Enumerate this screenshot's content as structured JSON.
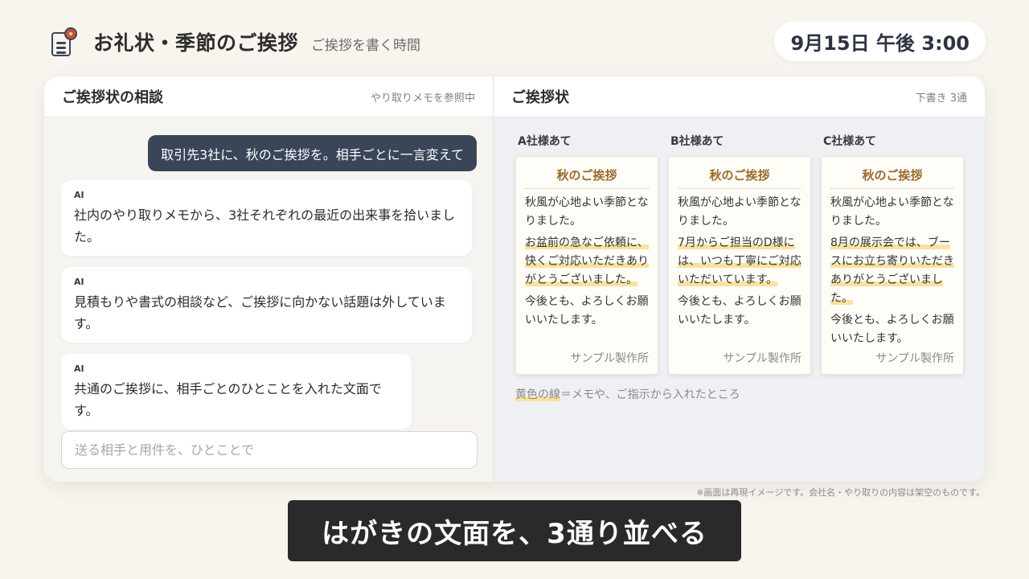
{
  "app": {
    "icon": "letter-icon",
    "title": "お礼状・季節のご挨拶",
    "subtitle": "ご挨拶を書く時間",
    "clock": "9月15日 午後 3:00"
  },
  "chat_panel": {
    "title": "ご挨拶状の相談",
    "meta": "やり取りメモを参照中",
    "user_message": "取引先3社に、秋のご挨拶を。相手ごとに一言変えて",
    "ai_messages": [
      {
        "label": "AI",
        "text": "社内のやり取りメモから、3社それぞれの最近の出来事を拾いました。"
      },
      {
        "label": "AI",
        "text": "見積もりや書式の相談など、ご挨拶に向かない話題は外しています。"
      },
      {
        "label": "AI",
        "text": "共通のご挨拶に、相手ごとのひとことを入れた文面です。"
      }
    ],
    "input_placeholder": "送る相手と用件を、ひとことで"
  },
  "letters_panel": {
    "title": "ご挨拶状",
    "meta": "下書き 3通",
    "letters": [
      {
        "to": "A社様あて",
        "title": "秋のご挨拶",
        "opening": "秋風が心地よい季節となりました。",
        "personal": "お盆前の急なご依頼に、快くご対応いただきありがとうございました。",
        "closing": "今後とも、よろしくお願いいたします。",
        "sign": "サンプル製作所"
      },
      {
        "to": "B社様あて",
        "title": "秋のご挨拶",
        "opening": "秋風が心地よい季節となりました。",
        "personal": "7月からご担当のD様には、いつも丁寧にご対応いただいています。",
        "closing": "今後とも、よろしくお願いいたします。",
        "sign": "サンプル製作所"
      },
      {
        "to": "C社様あて",
        "title": "秋のご挨拶",
        "opening": "秋風が心地よい季節となりました。",
        "personal": "8月の展示会では、ブースにお立ち寄りいただきありがとうございました。",
        "closing": "今後とも、よろしくお願いいたします。",
        "sign": "サンプル製作所"
      }
    ],
    "legend_key": "黄色の線",
    "legend_text": "＝メモや、ご指示から入れたところ"
  },
  "disclaimer": "※画面は再現イメージです。会社名・やり取りの内容は架空のものです。",
  "caption": "はがきの文面を、3通り並べる",
  "colors": {
    "background": "#f8f4ee",
    "user_bubble": "#3a4658",
    "letter_title": "#9a6a2b",
    "highlight": "#fbe1a0",
    "caption_bg": "#2a2a2a"
  }
}
